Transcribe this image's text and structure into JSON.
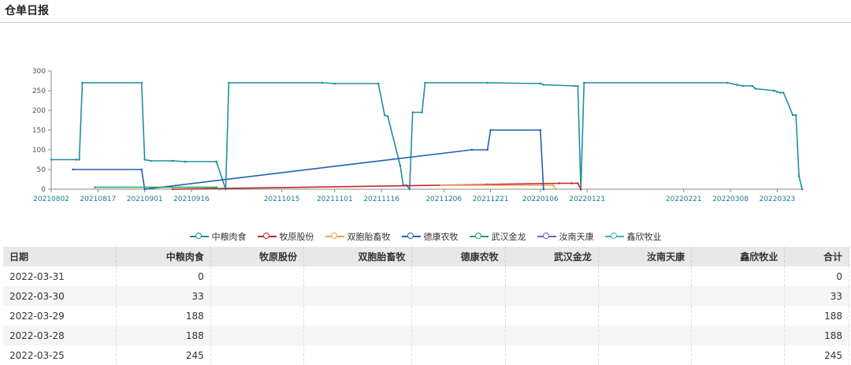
{
  "page": {
    "title": "仓单日报"
  },
  "chart_data": {
    "type": "line",
    "ylim": [
      0,
      300
    ],
    "yticks": [
      0,
      50,
      100,
      150,
      200,
      250,
      300
    ],
    "x_ticks": [
      "20210802",
      "20210817",
      "20210901",
      "20210916",
      "20211015",
      "20211101",
      "20211116",
      "20211206",
      "20211221",
      "20220106",
      "20220121",
      "20220221",
      "20220308",
      "20220323"
    ],
    "series": [
      {
        "name": "中粮肉食",
        "color": "#1f8f9e",
        "points": [
          [
            "2021-08-02",
            75
          ],
          [
            "2021-08-10",
            75
          ],
          [
            "2021-08-11",
            75
          ],
          [
            "2021-08-12",
            270
          ],
          [
            "2021-08-31",
            270
          ],
          [
            "2021-09-01",
            75
          ],
          [
            "2021-09-03",
            72
          ],
          [
            "2021-09-10",
            72
          ],
          [
            "2021-09-14",
            70
          ],
          [
            "2021-09-24",
            70
          ],
          [
            "2021-09-27",
            0
          ],
          [
            "2021-09-28",
            270
          ],
          [
            "2021-10-28",
            270
          ],
          [
            "2021-11-01",
            268
          ],
          [
            "2021-11-15",
            268
          ],
          [
            "2021-11-17",
            188
          ],
          [
            "2021-11-18",
            185
          ],
          [
            "2021-11-22",
            60
          ],
          [
            "2021-11-23",
            10
          ],
          [
            "2021-11-24",
            10
          ],
          [
            "2021-11-25",
            0
          ],
          [
            "2021-11-26",
            195
          ],
          [
            "2021-11-29",
            195
          ],
          [
            "2021-11-30",
            270
          ],
          [
            "2021-12-20",
            270
          ],
          [
            "2022-01-06",
            268
          ],
          [
            "2022-01-07",
            265
          ],
          [
            "2022-01-17",
            262
          ],
          [
            "2022-01-18",
            262
          ],
          [
            "2022-01-19",
            0
          ],
          [
            "2022-01-20",
            270
          ],
          [
            "2022-03-07",
            270
          ],
          [
            "2022-03-10",
            265
          ],
          [
            "2022-03-12",
            262
          ],
          [
            "2022-03-15",
            262
          ],
          [
            "2022-03-16",
            255
          ],
          [
            "2022-03-22",
            250
          ],
          [
            "2022-03-23",
            247
          ],
          [
            "2022-03-24",
            245
          ],
          [
            "2022-03-25",
            245
          ],
          [
            "2022-03-28",
            188
          ],
          [
            "2022-03-29",
            188
          ],
          [
            "2022-03-30",
            33
          ],
          [
            "2022-03-31",
            0
          ]
        ]
      },
      {
        "name": "牧原股份",
        "color": "#c0272d",
        "points": [
          [
            "2021-09-10",
            0
          ],
          [
            "2021-12-20",
            12
          ],
          [
            "2022-01-12",
            15
          ],
          [
            "2022-01-16",
            15
          ],
          [
            "2022-01-18",
            15
          ],
          [
            "2022-01-19",
            0
          ]
        ]
      },
      {
        "name": "双胞胎畜牧",
        "color": "#f5a055",
        "points": [
          [
            "2021-12-05",
            10
          ],
          [
            "2022-01-10",
            10
          ],
          [
            "2022-01-11",
            0
          ]
        ]
      },
      {
        "name": "德康农牧",
        "color": "#2162b0",
        "points": [
          [
            "2021-08-09",
            50
          ],
          [
            "2021-08-31",
            50
          ],
          [
            "2021-09-01",
            0
          ],
          [
            "2021-12-15",
            100
          ],
          [
            "2021-12-20",
            100
          ],
          [
            "2021-12-21",
            150
          ],
          [
            "2022-01-06",
            150
          ],
          [
            "2022-01-07",
            0
          ]
        ]
      },
      {
        "name": "武汉金龙",
        "color": "#27a358",
        "points": [
          [
            "2021-08-16",
            5
          ],
          [
            "2021-09-24",
            5
          ],
          [
            "2021-09-25",
            0
          ]
        ]
      },
      {
        "name": "汝南天康",
        "color": "#7a5ec6",
        "points": []
      },
      {
        "name": "鑫欣牧业",
        "color": "#3fb3c4",
        "points": []
      }
    ]
  },
  "table": {
    "headers": [
      "日期",
      "中粮肉食",
      "牧原股份",
      "双胞胎畜牧",
      "德康农牧",
      "武汉金龙",
      "汝南天康",
      "鑫欣牧业",
      "合计"
    ],
    "rows": [
      [
        "2022-03-31",
        "0",
        "",
        "",
        "",
        "",
        "",
        "",
        "0"
      ],
      [
        "2022-03-30",
        "33",
        "",
        "",
        "",
        "",
        "",
        "",
        "33"
      ],
      [
        "2022-03-29",
        "188",
        "",
        "",
        "",
        "",
        "",
        "",
        "188"
      ],
      [
        "2022-03-28",
        "188",
        "",
        "",
        "",
        "",
        "",
        "",
        "188"
      ],
      [
        "2022-03-25",
        "245",
        "",
        "",
        "",
        "",
        "",
        "",
        "245"
      ]
    ]
  }
}
